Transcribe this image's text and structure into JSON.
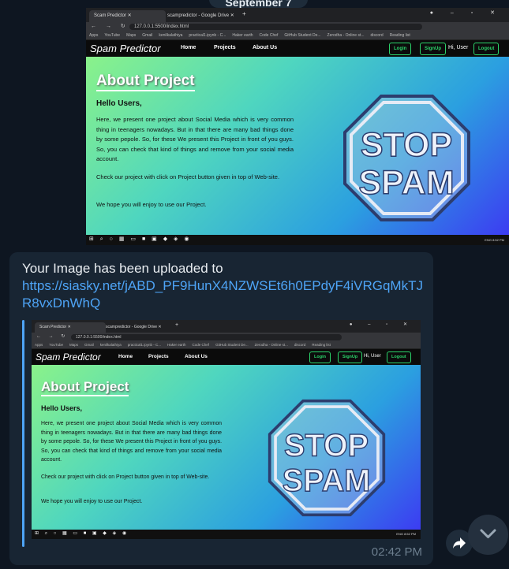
{
  "date_label": "September 7",
  "screenshot": {
    "tabs": [
      "Scam Predictor",
      "scampredictor - Google Drive"
    ],
    "address": "127.0.0.1:5500/index.html",
    "bookmarks": [
      "Apps",
      "YouTube",
      "Maps",
      "Gmail",
      "kenilkalathiya",
      "practical1.ipynb - C...",
      "Haker earth",
      "Code Chef",
      "GitHub Student De...",
      "Zerodha - Online st...",
      "discord",
      "Reading list"
    ],
    "brand": "Spam Predictor",
    "nav": [
      "Home",
      "Projects",
      "About Us"
    ],
    "login": "Login",
    "signup": "SignUp",
    "greeting": "Hi, User",
    "logout": "Logout",
    "title": "About Project",
    "hello": "Hello Users,",
    "para1": "Here, we present one project about Social Media which is very common thing in teenagers nowadays. But in that there are many bad things done by some pepole. So, for these We present this Project in front of you guys. So, you can check that kind of things and remove from your social media account.",
    "para2": "Check our project with click on Project button given in top of Web-site.",
    "para3": "We hope you will enjoy to use our Project.",
    "stop_word": "STOP",
    "spam_word": "SPAM",
    "tray": "ENG",
    "tray_time": "8:52 PM"
  },
  "message": {
    "text": "Your Image has been uploaded to",
    "link": "https://siasky.net/jABD_PF9HunX4NZWSEt6h0EPdyF4iVRGqMkTJR8vxDnWhQ",
    "time": "02:42 PM"
  },
  "icons": [
    "forward-icon",
    "chevron-down-icon"
  ]
}
